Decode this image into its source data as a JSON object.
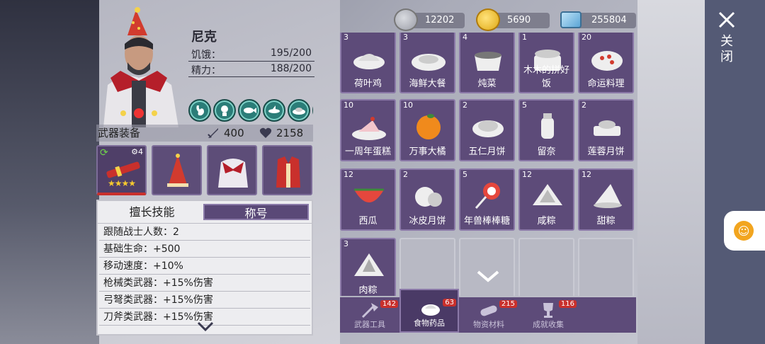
{
  "currency": [
    {
      "name": "silver-coin-stack-icon",
      "value": "12202"
    },
    {
      "name": "smiley-coin-icon",
      "value": "5690"
    },
    {
      "name": "photo-ticket-icon",
      "value": "255804"
    }
  ],
  "character": {
    "name": "尼克",
    "hunger_label": "饥饿：",
    "hunger_value": "195/200",
    "energy_label": "精力：",
    "energy_value": "188/200"
  },
  "weapon": {
    "label": "武器装备",
    "attack": "400",
    "health": "2158",
    "slot1_level": "4"
  },
  "skills": {
    "tab1": "擅长技能",
    "tab2": "称号",
    "lines": [
      "跟随战士人数：2",
      "基础生命：+500",
      "移动速度：+10%",
      "枪械类武器：+15%伤害",
      "弓弩类武器：+15%伤害",
      "刀斧类武器：+15%伤害"
    ]
  },
  "items": [
    {
      "count": "3",
      "name": "荷叶鸡"
    },
    {
      "count": "3",
      "name": "海鲜大餐"
    },
    {
      "count": "4",
      "name": "炖菜"
    },
    {
      "count": "1",
      "name": "木木的拼好饭"
    },
    {
      "count": "20",
      "name": "命运料理"
    },
    {
      "count": "10",
      "name": "一周年蛋糕"
    },
    {
      "count": "10",
      "name": "万事大橘"
    },
    {
      "count": "2",
      "name": "五仁月饼"
    },
    {
      "count": "5",
      "name": "留奈"
    },
    {
      "count": "2",
      "name": "莲蓉月饼"
    },
    {
      "count": "12",
      "name": "西瓜"
    },
    {
      "count": "2",
      "name": "冰皮月饼"
    },
    {
      "count": "5",
      "name": "年兽棒棒糖"
    },
    {
      "count": "12",
      "name": "咸粽"
    },
    {
      "count": "12",
      "name": "甜粽"
    },
    {
      "count": "3",
      "name": "肉粽"
    }
  ],
  "tabs": [
    {
      "label": "武器工具",
      "badge": "142"
    },
    {
      "label": "食物药品",
      "badge": "63"
    },
    {
      "label": "物资材料",
      "badge": "215"
    },
    {
      "label": "成就收集",
      "badge": "116"
    }
  ],
  "side": {
    "close_label": "关闭"
  },
  "colors": {
    "item_bg": "#5d4b79",
    "badge": "#c9302c",
    "buff": "#2b7d78",
    "side_panel": "#545a75"
  }
}
